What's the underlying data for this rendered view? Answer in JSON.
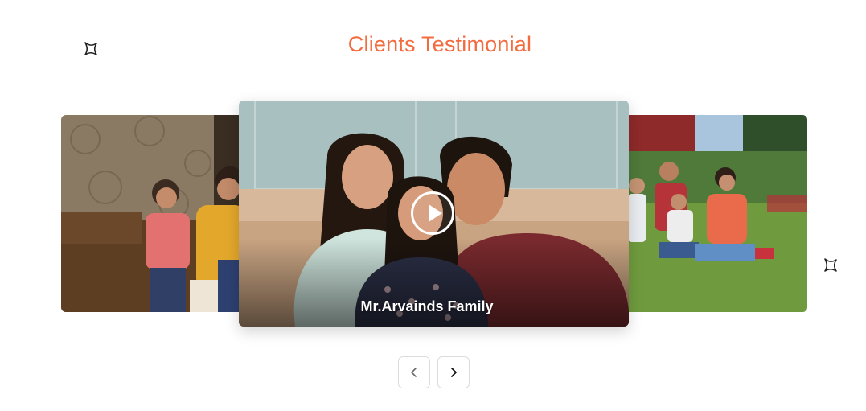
{
  "section": {
    "title": "Clients Testimonial",
    "accent_color": "#f36b3f"
  },
  "decorations": {
    "left_icon": "sparkle-icon",
    "right_icon": "sparkle-icon"
  },
  "carousel": {
    "slides": [
      {
        "position": "previous",
        "photo": "family-on-sofa-photo"
      },
      {
        "position": "active",
        "photo": "family-portrait-photo",
        "caption": "Mr.Arvainds Family",
        "has_video": true
      },
      {
        "position": "next",
        "photo": "family-on-lawn-photo"
      }
    ],
    "controls": {
      "prev_icon": "chevron-left-icon",
      "next_icon": "chevron-right-icon",
      "play_icon": "play-icon"
    }
  }
}
